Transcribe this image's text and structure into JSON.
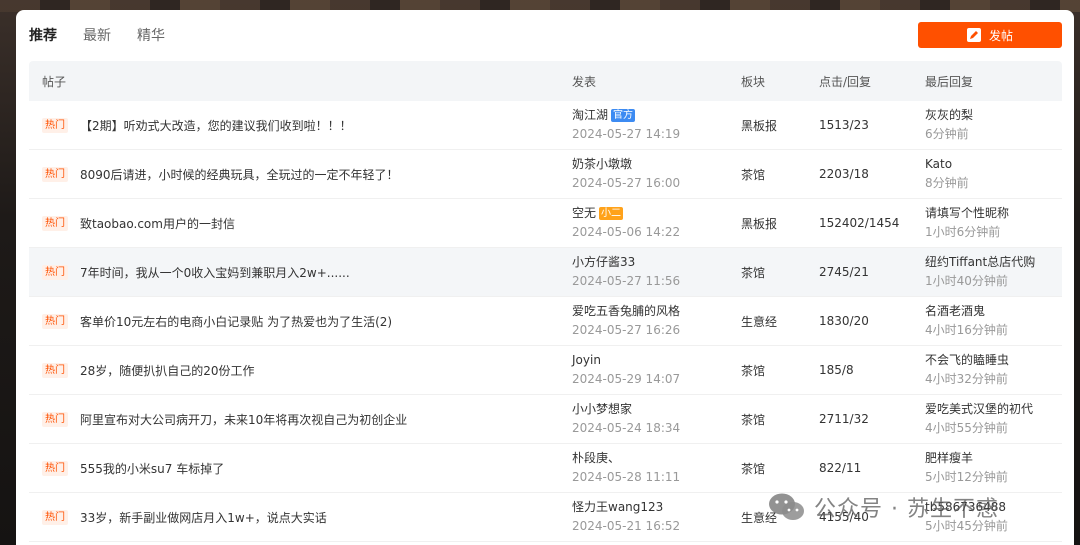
{
  "tabs": [
    {
      "label": "推荐",
      "active": true
    },
    {
      "label": "最新",
      "active": false
    },
    {
      "label": "精华",
      "active": false
    }
  ],
  "post_button": {
    "label": "发帖",
    "icon": "edit-icon",
    "color": "#ff5000"
  },
  "table": {
    "headers": {
      "post": "帖子",
      "author": "发表",
      "board": "板块",
      "stats": "点击/回复",
      "last_reply": "最后回复"
    },
    "rows": [
      {
        "tag": "热门",
        "title": "【2期】听劝式大改造，您的建议我们收到啦！！！",
        "author": "淘江湖",
        "badge": "官方",
        "badge_color": "blue",
        "date": "2024-05-27 14:19",
        "board": "黑板报",
        "stats": "1513/23",
        "last_user": "灰灰的梨",
        "last_time": "6分钟前"
      },
      {
        "tag": "热门",
        "title": "8090后请进，小时候的经典玩具，全玩过的一定不年轻了！",
        "author": "奶茶小墩墩",
        "badge": "",
        "badge_color": "",
        "date": "2024-05-27 16:00",
        "board": "茶馆",
        "stats": "2203/18",
        "last_user": "Kato",
        "last_time": "8分钟前"
      },
      {
        "tag": "热门",
        "title": "致taobao.com用户的一封信",
        "author": "空无",
        "badge": "小二",
        "badge_color": "orange",
        "date": "2024-05-06 14:22",
        "board": "黑板报",
        "stats": "152402/1454",
        "last_user": "请填写个性昵称",
        "last_time": "1小时6分钟前"
      },
      {
        "tag": "热门",
        "title": "7年时间，我从一个0收入宝妈到兼职月入2w+......",
        "author": "小方仔酱33",
        "badge": "",
        "badge_color": "",
        "date": "2024-05-27 11:56",
        "board": "茶馆",
        "stats": "2745/21",
        "last_user": "纽约Tiffant总店代购",
        "last_time": "1小时40分钟前"
      },
      {
        "tag": "热门",
        "title": "客单价10元左右的电商小白记录贴 为了热爱也为了生活(2)",
        "author": "爱吃五香兔脯的风格",
        "badge": "",
        "badge_color": "",
        "date": "2024-05-27 16:26",
        "board": "生意经",
        "stats": "1830/20",
        "last_user": "名酒老酒鬼",
        "last_time": "4小时16分钟前"
      },
      {
        "tag": "热门",
        "title": "28岁，随便扒扒自己的20份工作",
        "author": "Joyin",
        "badge": "",
        "badge_color": "",
        "date": "2024-05-29 14:07",
        "board": "茶馆",
        "stats": "185/8",
        "last_user": "不会飞的瞌睡虫",
        "last_time": "4小时32分钟前"
      },
      {
        "tag": "热门",
        "title": "阿里宣布对大公司病开刀，未来10年将再次视自己为初创企业",
        "author": "小小梦想家",
        "badge": "",
        "badge_color": "",
        "date": "2024-05-24 18:34",
        "board": "茶馆",
        "stats": "2711/32",
        "last_user": "爱吃美式汉堡的初代",
        "last_time": "4小时55分钟前"
      },
      {
        "tag": "热门",
        "title": "555我的小米su7 车标掉了",
        "author": "朴段庚、",
        "badge": "",
        "badge_color": "",
        "date": "2024-05-28 11:11",
        "board": "茶馆",
        "stats": "822/11",
        "last_user": "肥样瘦羊",
        "last_time": "5小时12分钟前"
      },
      {
        "tag": "热门",
        "title": "33岁，新手副业做网店月入1w+，说点大实话",
        "author": "怪力王wang123",
        "badge": "",
        "badge_color": "",
        "date": "2024-05-21 16:52",
        "board": "生意经",
        "stats": "4155/40",
        "last_user": "tb586736488",
        "last_time": "5小时45分钟前"
      }
    ]
  },
  "watermark": {
    "text": "公众号 · 苏生不惑",
    "icon": "wechat-icon"
  }
}
